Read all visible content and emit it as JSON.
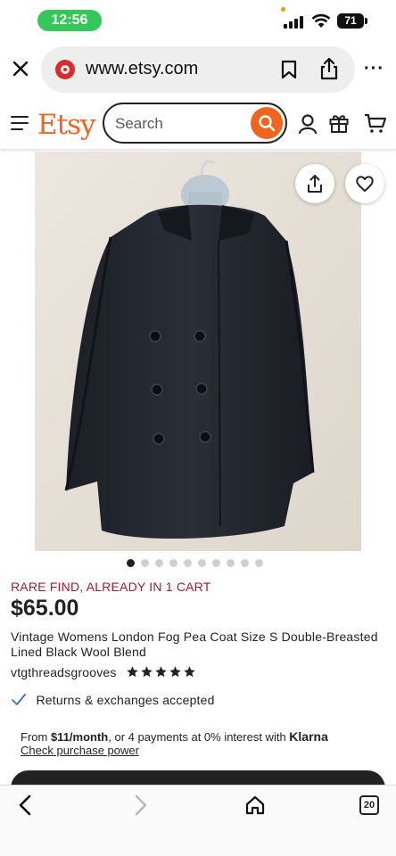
{
  "status_bar": {
    "time": "12:56",
    "battery": "71"
  },
  "browser": {
    "url": "www.etsy.com",
    "tab_count": "20",
    "more_label": "···"
  },
  "header": {
    "logo": "Etsy",
    "search_placeholder": "Search"
  },
  "carousel": {
    "total": 10,
    "active_index": 0
  },
  "product": {
    "badge": "RARE FIND, ALREADY IN 1 CART",
    "price": "$65.00",
    "title": "Vintage Womens London Fog Pea Coat Size S Double-Breasted Lined Black Wool Blend",
    "shop_name": "vtgthreadsgrooves",
    "rating": 5,
    "returns": "Returns & exchanges accepted"
  },
  "klarna": {
    "prefix": "From ",
    "amount": "$11/month",
    "suffix": ", or 4 payments at 0% interest with ",
    "brand": "Klarna",
    "link": "Check purchase power"
  },
  "colors": {
    "accent": "#f1641e",
    "badge": "#a61a2e",
    "check": "#3b6fb6"
  }
}
